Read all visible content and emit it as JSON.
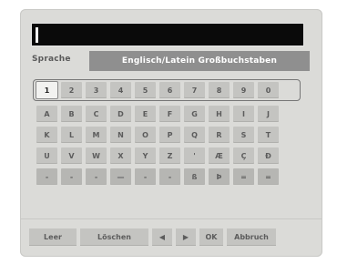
{
  "input": {
    "value": ""
  },
  "language": {
    "label": "Sprache",
    "value": "Englisch/Latein Großbuchstaben"
  },
  "keyboard": {
    "rows": [
      [
        "1",
        "2",
        "3",
        "4",
        "5",
        "6",
        "7",
        "8",
        "9",
        "0"
      ],
      [
        "A",
        "B",
        "C",
        "D",
        "E",
        "F",
        "G",
        "H",
        "I",
        "J"
      ],
      [
        "K",
        "L",
        "M",
        "N",
        "O",
        "P",
        "Q",
        "R",
        "S",
        "T"
      ],
      [
        "U",
        "V",
        "W",
        "X",
        "Y",
        "Z",
        "'",
        "Æ",
        "Ç",
        "Ð"
      ],
      [
        "-",
        "-",
        "-",
        "—",
        "-",
        "-",
        "ß",
        "Þ",
        "=",
        "="
      ]
    ],
    "selected": "1"
  },
  "buttons": {
    "space": "Leer",
    "delete": "Löschen",
    "left": "◀",
    "right": "▶",
    "ok": "OK",
    "cancel": "Abbruch"
  }
}
